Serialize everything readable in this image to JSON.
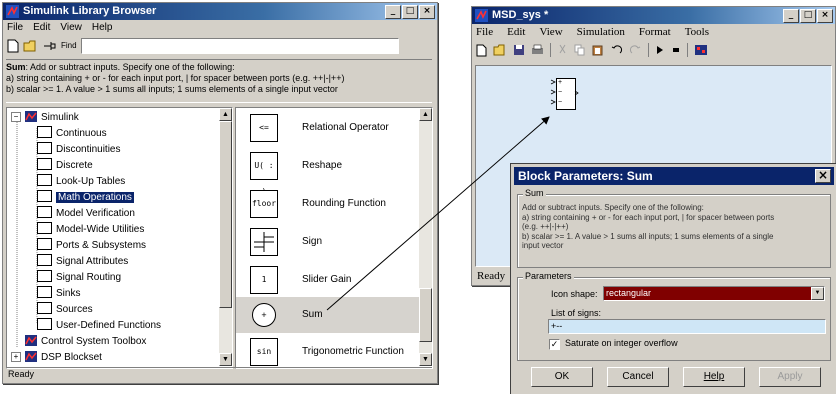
{
  "library_browser": {
    "title": "Simulink Library Browser",
    "menu": [
      "File",
      "Edit",
      "View",
      "Help"
    ],
    "find_label": "Find",
    "description_title": "Sum",
    "description_lines": [
      ": Add or subtract inputs.  Specify one of the following:",
      "a) string containing + or - for each input port, | for spacer between ports (e.g. ++|-|++)",
      "b) scalar >= 1. A value > 1 sums all inputs; 1 sums elements of a single input vector"
    ],
    "tree": {
      "root": "Simulink",
      "root_toggle": "−",
      "items": [
        "Continuous",
        "Discontinuities",
        "Discrete",
        "Look-Up Tables",
        "Math Operations",
        "Model Verification",
        "Model-Wide Utilities",
        "Ports & Subsystems",
        "Signal Attributes",
        "Signal Routing",
        "Sinks",
        "Sources",
        "User-Defined Functions"
      ],
      "selected": "Math Operations",
      "other_roots": [
        "Control System Toolbox",
        "DSP Blockset"
      ],
      "dsp_toggle": "+"
    },
    "blocks": [
      {
        "glyph": "<=",
        "label": "Relational Operator"
      },
      {
        "glyph": "U( : )",
        "label": "Reshape"
      },
      {
        "glyph": "floor",
        "label": "Rounding Function"
      },
      {
        "glyph": "",
        "label": "Sign"
      },
      {
        "glyph": "1",
        "label": "Slider Gain"
      },
      {
        "glyph": "+",
        "label": "Sum"
      },
      {
        "glyph": "sin",
        "label": "Trigonometric Function"
      }
    ],
    "status": "Ready"
  },
  "model_window": {
    "title": "MSD_sys *",
    "menu": [
      "File",
      "Edit",
      "View",
      "Simulation",
      "Format",
      "Tools"
    ],
    "status": "Ready",
    "sum_block_ports": [
      "+",
      "−",
      "−"
    ]
  },
  "block_params": {
    "title": "Block Parameters: Sum",
    "close_glyph": "×",
    "section_label": "Sum",
    "description_lines": [
      "Add or subtract inputs.  Specify one of the following:",
      "a) string containing + or - for each input port, | for spacer between ports",
      "(e.g. ++|-|++)",
      "b) scalar >= 1. A value > 1 sums all inputs; 1 sums elements of a single",
      "input vector"
    ],
    "parameters_label": "Parameters",
    "icon_shape_label": "Icon shape:",
    "icon_shape_value": "rectangular",
    "list_of_signs_label": "List of signs:",
    "list_of_signs_value": "+--",
    "saturate_label": "Saturate on integer overflow",
    "saturate_checked": true,
    "buttons": {
      "ok": "OK",
      "cancel": "Cancel",
      "help": "Help",
      "apply": "Apply"
    }
  },
  "colors": {
    "title_active": "#0a246a",
    "model_canvas": "#dbe9f6",
    "selected_item": "#0a246a",
    "icon_shape_field": "#800000",
    "signs_field": "#cfe6f6"
  }
}
